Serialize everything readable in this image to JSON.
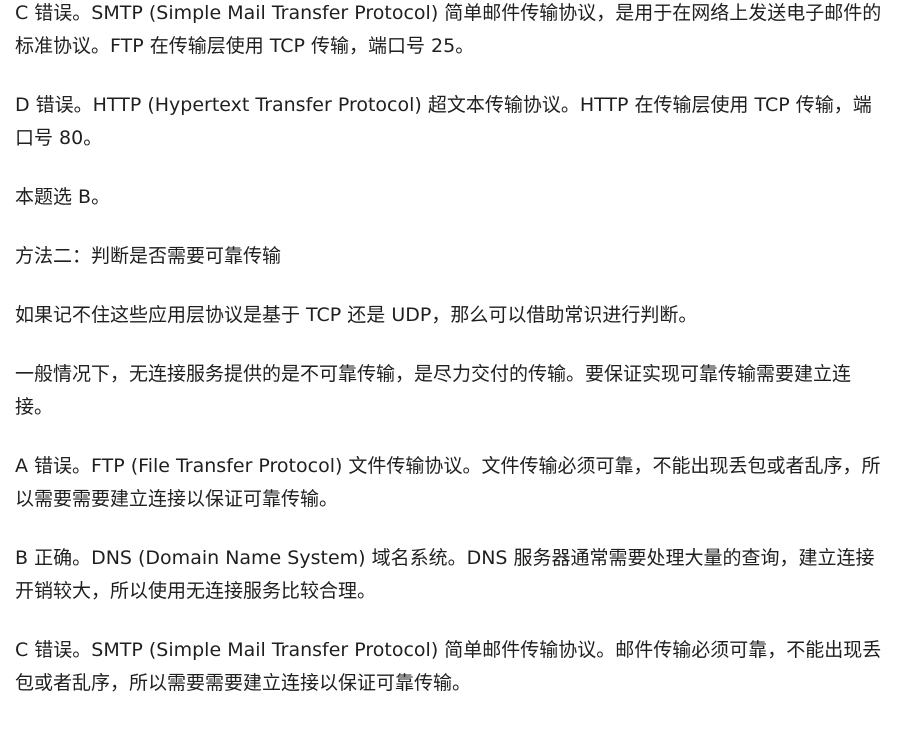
{
  "paragraphs": [
    "C 错误。SMTP (Simple Mail Transfer Protocol) 简单邮件传输协议，是用于在网络上发送电子邮件的标准协议。FTP 在传输层使用 TCP 传输，端口号 25。",
    "D 错误。HTTP (Hypertext Transfer Protocol) 超文本传输协议。HTTP 在传输层使用 TCP 传输，端口号 80。",
    "本题选 B。",
    "方法二：判断是否需要可靠传输",
    "如果记不住这些应用层协议是基于 TCP 还是 UDP，那么可以借助常识进行判断。",
    "一般情况下，无连接服务提供的是不可靠传输，是尽力交付的传输。要保证实现可靠传输需要建立连接。",
    "A 错误。FTP (File Transfer Protocol) 文件传输协议。文件传输必须可靠，不能出现丢包或者乱序，所以需要需要建立连接以保证可靠传输。",
    "B 正确。DNS (Domain Name System) 域名系统。DNS 服务器通常需要处理大量的查询，建立连接开销较大，所以使用无连接服务比较合理。",
    "C 错误。SMTP (Simple Mail Transfer Protocol) 简单邮件传输协议。邮件传输必须可靠，不能出现丢包或者乱序，所以需要需要建立连接以保证可靠传输。"
  ]
}
